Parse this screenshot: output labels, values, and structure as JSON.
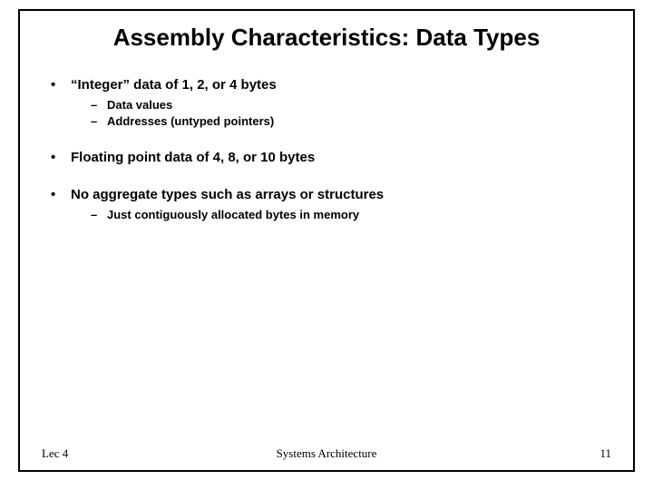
{
  "title": "Assembly Characteristics: Data Types",
  "bullets": [
    {
      "text": "“Integer” data of 1, 2, or 4 bytes",
      "sub": [
        "Data values",
        "Addresses (untyped pointers)"
      ]
    },
    {
      "text": "Floating point data of 4, 8, or 10 bytes",
      "sub": []
    },
    {
      "text": "No aggregate types such as arrays or structures",
      "sub": [
        "Just contiguously allocated bytes in memory"
      ]
    }
  ],
  "footer": {
    "left": "Lec 4",
    "center": "Systems Architecture",
    "right": "11"
  }
}
